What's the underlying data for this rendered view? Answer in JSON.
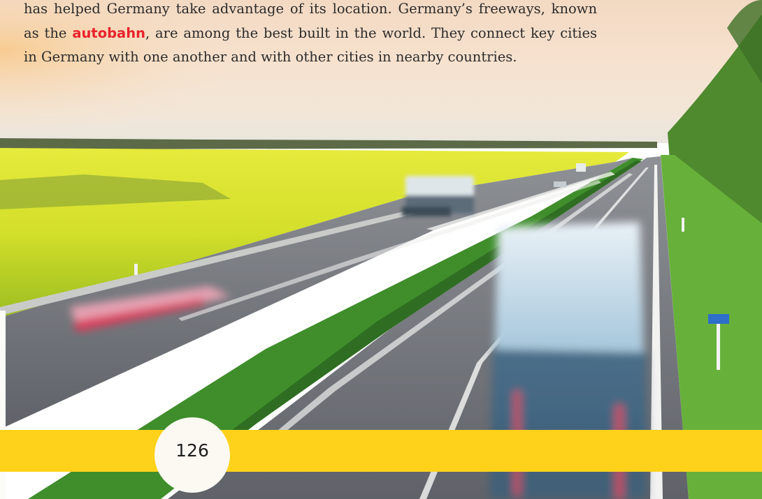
{
  "passage": {
    "text_before_keyword": "has helped Germany take advantage of its location. Germany’s freeways, known as the ",
    "keyword": "autobahn",
    "text_after_keyword": ", are among the best built in the world. They connect key cities in Germany with one another and with other cities in nearby countries."
  },
  "footer": {
    "page_number": "126"
  },
  "colors": {
    "keyword": "#e8232b",
    "footer_band": "#fed21a",
    "page_circle": "#fbf9f2"
  }
}
